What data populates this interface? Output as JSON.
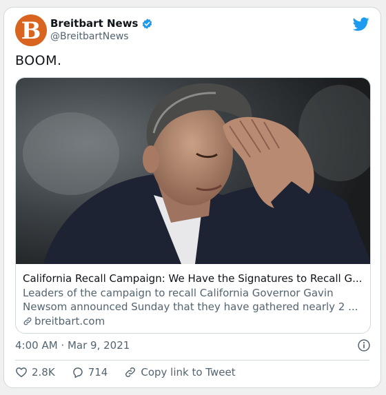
{
  "author": {
    "avatar_letter": "B",
    "display_name": "Breitbart News",
    "handle": "@BreitbartNews",
    "verified_icon": "verified-badge-icon",
    "brand_color": "#d8641f"
  },
  "tweet": {
    "text": "BOOM.",
    "timestamp": "4:00 AM · Mar 9, 2021"
  },
  "link_card": {
    "title": "California Recall Campaign: We Have the Signatures to Recall G...",
    "description_line1": "Leaders of the campaign to recall California Governor Gavin",
    "description_line2": "Newsom announced Sunday that they have gathered nearly 2 ...",
    "domain": "breitbart.com"
  },
  "actions": {
    "likes": "2.8K",
    "replies": "714",
    "copy_link": "Copy link to Tweet"
  },
  "colors": {
    "twitter_blue": "#1d9bf0",
    "text_secondary": "#536471",
    "border": "#cfd9de"
  }
}
